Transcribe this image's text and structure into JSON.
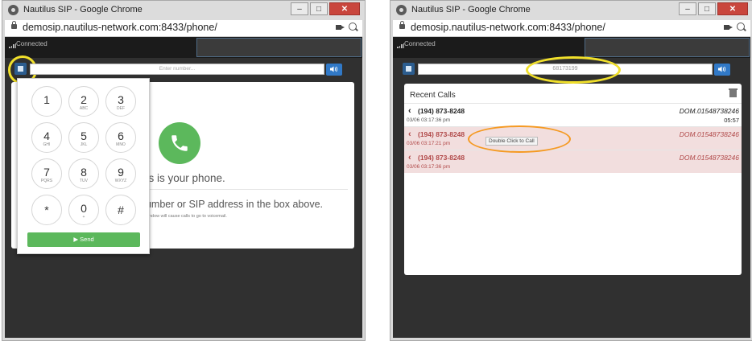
{
  "window_title": "Nautilus SIP - Google Chrome",
  "window_controls": {
    "minimize": "–",
    "maximize": "□",
    "close": "✕"
  },
  "url": "demosip.nautilus-network.com:8433/phone/",
  "status": "Connected",
  "left": {
    "input_placeholder": "Enter number...",
    "keys": [
      {
        "digit": "1",
        "letters": ""
      },
      {
        "digit": "2",
        "letters": "ABC"
      },
      {
        "digit": "3",
        "letters": "DEF"
      },
      {
        "digit": "4",
        "letters": "GHI"
      },
      {
        "digit": "5",
        "letters": "JKL"
      },
      {
        "digit": "6",
        "letters": "MNO"
      },
      {
        "digit": "7",
        "letters": "PQRS"
      },
      {
        "digit": "8",
        "letters": "TUV"
      },
      {
        "digit": "9",
        "letters": "WXYZ"
      },
      {
        "digit": "*",
        "letters": ""
      },
      {
        "digit": "0",
        "letters": "+"
      },
      {
        "digit": "#",
        "letters": ""
      }
    ],
    "send_label": "▶ Send",
    "this_phone": "his is your phone.",
    "enter_hint": "number or SIP address in the box above.",
    "voicemail_note": "le window will cause calls to go to voicemail."
  },
  "right": {
    "input_value": "68173199",
    "recent_title": "Recent Calls",
    "tooltip": "Double Click to Call",
    "calls": [
      {
        "number": "(194) 873-8248",
        "name": "DOM.01548738246",
        "time": "03/06 03:17:36 pm",
        "duration": "05:57",
        "missed": false
      },
      {
        "number": "(194) 873-8248",
        "name": "DOM.01548738246",
        "time": "03/06 03:17:21 pm",
        "duration": "",
        "missed": true
      },
      {
        "number": "(194) 873-8248",
        "name": "DOM.01548738246",
        "time": "03/06 03:17:36 pm",
        "duration": "",
        "missed": true
      }
    ]
  },
  "colors": {
    "accent": "#3179c7",
    "success": "#5cb85c",
    "highlight_ring": "#f1e02b",
    "tooltip_ring": "#f59a23",
    "missed_row": "#f2dede"
  }
}
